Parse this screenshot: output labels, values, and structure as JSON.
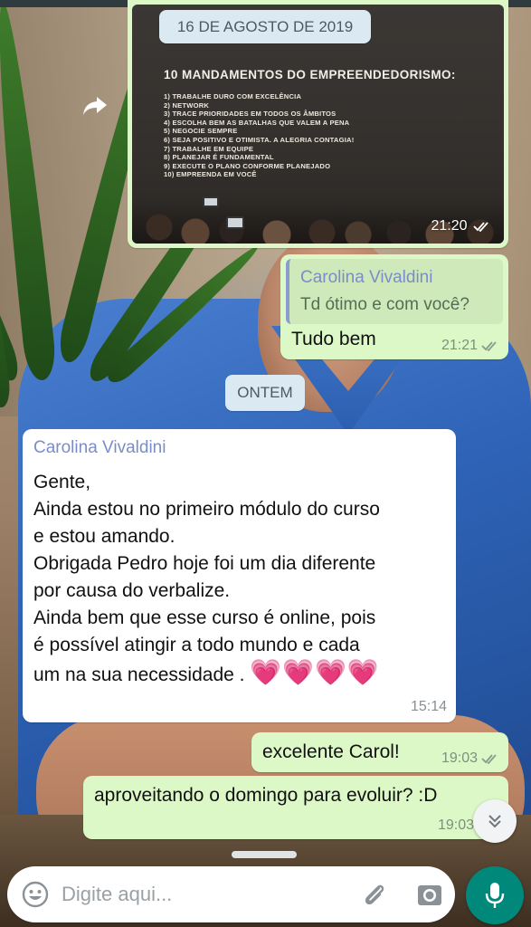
{
  "image_message": {
    "slide_title": "10 MANDAMENTOS DO EMPREENDEDORISMO:",
    "slide_items": [
      "1) TRABALHE DURO COM EXCELÊNCIA",
      "2) NETWORK",
      "3) TRACE PRIORIDADES EM TODOS OS ÂMBITOS",
      "4) ESCOLHA BEM AS BATALHAS QUE VALEM A PENA",
      "5) NEGOCIE SEMPRE",
      "6) SEJA POSITIVO E OTIMISTA. A ALEGRIA CONTAGIA!",
      "7) TRABALHE EM EQUIPE",
      "8) PLANEJAR É FUNDAMENTAL",
      "9) EXECUTE O PLANO CONFORME PLANEJADO",
      "10) EMPREENDA EM VOCÊ"
    ],
    "time": "21:20"
  },
  "date_chip": "16 DE AGOSTO DE 2019",
  "reply_message": {
    "quoted_name": "Carolina Vivaldini",
    "quoted_text": "Td ótimo e com você?",
    "text": "Tudo bem",
    "time": "21:21"
  },
  "day_chip": "ONTEM",
  "incoming_message": {
    "sender": "Carolina Vivaldini",
    "lines": [
      "Gente,",
      "Ainda estou no primeiro módulo do curso",
      "e estou amando.",
      "Obrigada Pedro hoje foi um dia diferente",
      "por causa do verbalize.",
      "Ainda bem que esse curso é online, pois",
      "é possível atingir a todo mundo e cada",
      "um na sua necessidade ."
    ],
    "hearts": "💗💗💗💗",
    "time": "15:14"
  },
  "outgoing_1": {
    "text": "excelente Carol!",
    "time": "19:03"
  },
  "outgoing_2": {
    "text": "aproveitando o domingo para evoluir? :D",
    "time": "19:03"
  },
  "composer": {
    "placeholder": "Digite aqui..."
  },
  "colors": {
    "outgoing_bubble": "#dcf8c6",
    "incoming_bubble": "#ffffff",
    "sender_name": "#7a8dc7",
    "mic_button": "#00897b",
    "date_chip": "#dbe9f3"
  },
  "icons": [
    "forward-icon",
    "double-check-icon",
    "chevron-down-icon",
    "emoji-icon",
    "paperclip-icon",
    "camera-icon",
    "mic-icon"
  ]
}
